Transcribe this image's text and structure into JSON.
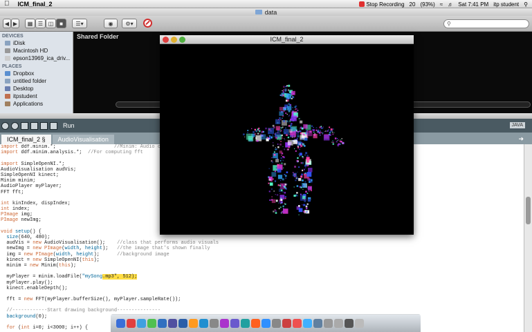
{
  "menubar": {
    "app_name": "ICM_final_2",
    "stop_recording": "Stop Recording",
    "battery": "(93%)",
    "clock": "Sat 7:41 PM",
    "user": "itp student",
    "num": "20"
  },
  "finder": {
    "title": "data",
    "search_placeholder": "",
    "devices_header": "DEVICES",
    "places_header": "PLACES",
    "devices": [
      "iDisk",
      "Macintosh HD",
      "epson13969_ica_driv..."
    ],
    "places": [
      "Dropbox",
      "untitled folder",
      "Desktop",
      "itpstudent",
      "Applications"
    ],
    "shared_folder": "Shared Folder"
  },
  "processing": {
    "run_label": "Run",
    "java_label": "JAVA",
    "tabs": [
      "ICM_final_2 §",
      "AudioVisualisation"
    ],
    "code": [
      [
        {
          "t": "import ",
          "c": "kw"
        },
        {
          "t": "ddf.minim.*;                    "
        },
        {
          "t": "//Minim: Audio control library",
          "c": "cm"
        }
      ],
      [
        {
          "t": "import ",
          "c": "kw"
        },
        {
          "t": "ddf.minim.analysis.*;  "
        },
        {
          "t": "//For computing fft",
          "c": "cm"
        }
      ],
      [
        {
          "t": ""
        }
      ],
      [
        {
          "t": "import ",
          "c": "kw"
        },
        {
          "t": "SimpleOpenNI.*;"
        }
      ],
      [
        {
          "t": "AudioVisualisation audVis;"
        }
      ],
      [
        {
          "t": "SimpleOpenNI kinect;"
        }
      ],
      [
        {
          "t": "Minim minim;"
        }
      ],
      [
        {
          "t": "AudioPlayer myPlayer;"
        }
      ],
      [
        {
          "t": "FFT fft;"
        }
      ],
      [
        {
          "t": ""
        }
      ],
      [
        {
          "t": "int ",
          "c": "ty"
        },
        {
          "t": "kinIndex, dispIndex;"
        }
      ],
      [
        {
          "t": "int ",
          "c": "ty"
        },
        {
          "t": "index;"
        }
      ],
      [
        {
          "t": "PImage ",
          "c": "ty"
        },
        {
          "t": "img;"
        }
      ],
      [
        {
          "t": "PImage ",
          "c": "ty"
        },
        {
          "t": "newImg;"
        }
      ],
      [
        {
          "t": ""
        }
      ],
      [
        {
          "t": "void ",
          "c": "ty"
        },
        {
          "t": "setup",
          "c": "st"
        },
        {
          "t": "() {"
        }
      ],
      [
        {
          "t": "  "
        },
        {
          "t": "size",
          "c": "st"
        },
        {
          "t": "(640, 480);"
        }
      ],
      [
        {
          "t": "  audVis = "
        },
        {
          "t": "new ",
          "c": "kw"
        },
        {
          "t": "AudioVisualisation();    "
        },
        {
          "t": "//class that performs audio visuals",
          "c": "cm"
        }
      ],
      [
        {
          "t": "  newImg = "
        },
        {
          "t": "new ",
          "c": "kw"
        },
        {
          "t": "PImage",
          "c": "ty"
        },
        {
          "t": "("
        },
        {
          "t": "width",
          "c": "st"
        },
        {
          "t": ", "
        },
        {
          "t": "height",
          "c": "st"
        },
        {
          "t": ");   "
        },
        {
          "t": "//the image that's shown finally",
          "c": "cm"
        }
      ],
      [
        {
          "t": "  img = "
        },
        {
          "t": "new ",
          "c": "kw"
        },
        {
          "t": "PImage",
          "c": "ty"
        },
        {
          "t": "("
        },
        {
          "t": "width",
          "c": "st"
        },
        {
          "t": ", "
        },
        {
          "t": "height",
          "c": "st"
        },
        {
          "t": ");      "
        },
        {
          "t": "//background image",
          "c": "cm"
        }
      ],
      [
        {
          "t": "  kinect = "
        },
        {
          "t": "new ",
          "c": "kw"
        },
        {
          "t": "SimpleOpenNI("
        },
        {
          "t": "this",
          "c": "kw"
        },
        {
          "t": ");"
        }
      ],
      [
        {
          "t": "  minim = "
        },
        {
          "t": "new ",
          "c": "kw"
        },
        {
          "t": "Minim("
        },
        {
          "t": "this",
          "c": "kw"
        },
        {
          "t": ");"
        }
      ],
      [
        {
          "t": ""
        }
      ],
      [
        {
          "t": "  myPlayer = minim.loadFile("
        },
        {
          "t": "\"mySong",
          "c": "st"
        },
        {
          "t": ".mp3\"",
          "c": "hl"
        },
        {
          "t": ", 512);",
          "c": "hl"
        }
      ],
      [
        {
          "t": "  myPlayer.play();"
        }
      ],
      [
        {
          "t": "  kinect.enableDepth();"
        }
      ],
      [
        {
          "t": ""
        }
      ],
      [
        {
          "t": "  fft = "
        },
        {
          "t": "new ",
          "c": "kw"
        },
        {
          "t": "FFT(myPlayer.bufferSize(), myPlayer.sampleRate());"
        }
      ],
      [
        {
          "t": ""
        }
      ],
      [
        {
          "t": "  "
        },
        {
          "t": "//------------Start drawing background---------------",
          "c": "cm"
        }
      ],
      [
        {
          "t": "  "
        },
        {
          "t": "background",
          "c": "st"
        },
        {
          "t": "(0);"
        }
      ],
      [
        {
          "t": ""
        }
      ],
      [
        {
          "t": "  "
        },
        {
          "t": "for ",
          "c": "kw"
        },
        {
          "t": "("
        },
        {
          "t": "int ",
          "c": "ty"
        },
        {
          "t": "i=0; i<3000; i++) {"
        }
      ]
    ]
  },
  "sketch": {
    "title": "ICM_final_2"
  },
  "colors": {
    "editor_toolbar": "#4a5a62",
    "highlight": "#ffdd44",
    "particle_blue": "#3355ff",
    "particle_magenta": "#cc33cc"
  }
}
